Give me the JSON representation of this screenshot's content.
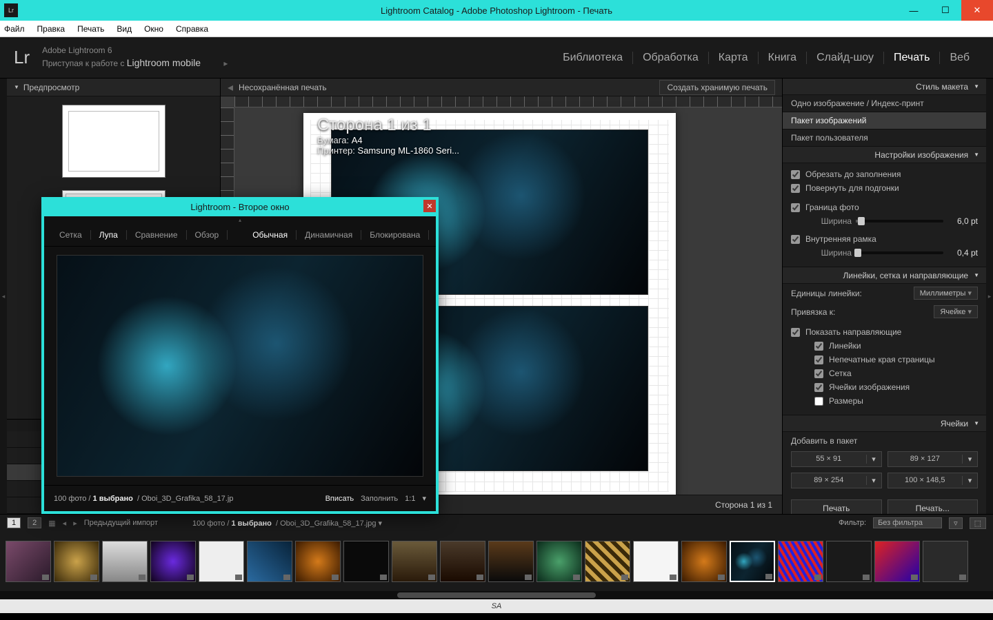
{
  "window": {
    "title": "Lightroom Catalog - Adobe Photoshop Lightroom - Печать",
    "app_badge": "Lr"
  },
  "menu": [
    "Файл",
    "Правка",
    "Печать",
    "Вид",
    "Окно",
    "Справка"
  ],
  "lr_header": {
    "logo": "Lr",
    "product": "Adobe Lightroom 6",
    "mobile_line_prefix": "Приступая к работе с ",
    "mobile_line_em": "Lightroom mobile",
    "modules": [
      "Библиотека",
      "Обработка",
      "Карта",
      "Книга",
      "Слайд-шоу",
      "Печать",
      "Веб"
    ],
    "active_module": 5
  },
  "left": {
    "preview_title": "Предпросмотр"
  },
  "center": {
    "unsaved": "Несохранённая печать",
    "create_btn": "Создать хранимую печать",
    "overlay": {
      "page": "Сторона 1 из 1",
      "paper_label": "Бумага:",
      "paper_value": "A4",
      "printer_label": "Принтер:",
      "printer_value": "Samsung ML-1860 Seri..."
    },
    "footer_page": "Сторона 1 из 1"
  },
  "right": {
    "s1": "Стиль макета",
    "layout_styles": [
      "Одно изображение / Индекс-принт",
      "Пакет изображений",
      "Пакет пользователя"
    ],
    "layout_sel": 1,
    "s2": "Настройки изображения",
    "cb_crop": "Обрезать до заполнения",
    "cb_rotate": "Повернуть для подгонки",
    "cb_border": "Граница фото",
    "border_width_label": "Ширина",
    "border_width_val": "6,0",
    "border_width_unit": "pt",
    "cb_inner": "Внутренняя рамка",
    "inner_width_label": "Ширина",
    "inner_width_val": "0,4",
    "inner_width_unit": "pt",
    "s3": "Линейки, сетка и направляющие",
    "ruler_units_label": "Единицы линейки:",
    "ruler_units_val": "Миллиметры",
    "snap_label": "Привязка к:",
    "snap_val": "Ячейке",
    "cb_show_guides": "Показать направляющие",
    "sub_cbs": [
      "Линейки",
      "Непечатные края страницы",
      "Сетка",
      "Ячейки изображения",
      "Размеры"
    ],
    "s4": "Ячейки",
    "add_pkg": "Добавить в пакет",
    "size_btns": [
      "55 × 91",
      "89 × 127",
      "89 × 254",
      "100 × 148,5"
    ],
    "print_btn": "Печать",
    "print_dlg_btn": "Печать..."
  },
  "footer": {
    "screen_badges": [
      "1",
      "2"
    ],
    "prev_import": "Предыдущий импорт",
    "count": "100 фото",
    "selected": "1 выбрано",
    "filename": "Oboi_3D_Grafika_58_17.jpg",
    "filter_label": "Фильтр:",
    "filter_val": "Без фильтра"
  },
  "second_window": {
    "title": "Lightroom - Второе окно",
    "tabs_left": [
      "Сетка",
      "Лупа",
      "Сравнение",
      "Обзор"
    ],
    "tabs_left_active": 1,
    "tabs_right": [
      "Обычная",
      "Динамичная",
      "Блокирована"
    ],
    "tabs_right_active": 0,
    "foot_count": "100 фото",
    "foot_sel": "1 выбрано",
    "foot_file": "Oboi_3D_Grafika_58_17.jp",
    "fit": "Вписать",
    "fill": "Заполнить",
    "ratio": "1:1"
  },
  "status_bar": "SA"
}
